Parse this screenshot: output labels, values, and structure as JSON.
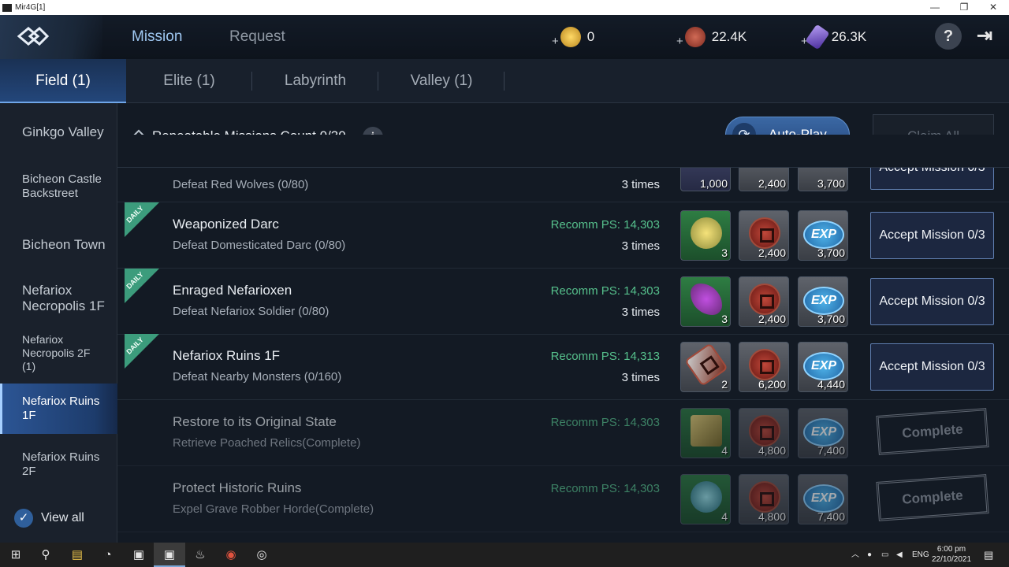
{
  "window": {
    "title": "Mir4G[1]",
    "minimize": "—",
    "restore": "❐",
    "close": "✕"
  },
  "header": {
    "main_tabs": [
      {
        "label": "Mission"
      },
      {
        "label": "Request"
      }
    ],
    "currencies": [
      {
        "name": "gold-icon",
        "value": "0",
        "color": "#e0b43a"
      },
      {
        "name": "copper-icon",
        "value": "22.4K",
        "color": "#b3523f"
      },
      {
        "name": "darksteel-icon",
        "value": "26.3K",
        "color": "#7a5bd0"
      }
    ],
    "help": "?",
    "exit": "⇥"
  },
  "sub_tabs": [
    {
      "label": "Field (1)"
    },
    {
      "label": "Elite (1)"
    },
    {
      "label": "Labyrinth"
    },
    {
      "label": "Valley (1)"
    }
  ],
  "sidebar": {
    "regions": [
      {
        "label": "Ginkgo Valley"
      },
      {
        "label": "Bicheon Castle Backstreet"
      },
      {
        "label": "Bicheon Town"
      },
      {
        "label": "Nefariox Necropolis 1F"
      },
      {
        "label": "Nefariox Necropolis 2F (1)"
      },
      {
        "label": "Nefariox Ruins 1F"
      },
      {
        "label": "Nefariox Ruins 2F"
      }
    ],
    "view_all": "View all",
    "check": "✓"
  },
  "toolbar": {
    "repeatable": "Repeatable Missions Count 0/30",
    "info": "i",
    "auto_play": "Auto-Play",
    "refresh": "⟳",
    "claim_all": "Claim All"
  },
  "missions": [
    {
      "title": "",
      "subtitle": "Defeat Red Wolves (0/80)",
      "ps": "",
      "times": "3 times",
      "daily": "",
      "rewards": [
        "1,000",
        "2,400",
        "3,700"
      ],
      "action": "Accept Mission 0/3"
    },
    {
      "title": "Weaponized Darc",
      "subtitle": "Defeat Domesticated Darc (0/80)",
      "ps": "Recomm PS: 14,303",
      "times": "3 times",
      "daily": "DAILY",
      "rewards": [
        "3",
        "2,400",
        "3,700"
      ],
      "action": "Accept Mission 0/3"
    },
    {
      "title": "Enraged Nefarioxen",
      "subtitle": "Defeat Nefariox Soldier (0/80)",
      "ps": "Recomm PS: 14,303",
      "times": "3 times",
      "daily": "DAILY",
      "rewards": [
        "3",
        "2,400",
        "3,700"
      ],
      "action": "Accept Mission 0/3"
    },
    {
      "title": "Nefariox Ruins 1F",
      "subtitle": "Defeat Nearby Monsters (0/160)",
      "ps": "Recomm PS: 14,313",
      "times": "3 times",
      "daily": "DAILY",
      "rewards": [
        "2",
        "6,200",
        "4,440"
      ],
      "action": "Accept Mission 0/3"
    },
    {
      "title": "Restore to its Original State",
      "subtitle": "Retrieve Poached Relics(Complete)",
      "ps": "Recomm PS: 14,303",
      "times": "",
      "daily": "",
      "rewards": [
        "4",
        "4,800",
        "7,400"
      ],
      "action": "Complete"
    },
    {
      "title": "Protect Historic Ruins",
      "subtitle": "Expel Grave Robber Horde(Complete)",
      "ps": "Recomm PS: 14,303",
      "times": "",
      "daily": "",
      "rewards": [
        "4",
        "4,800",
        "7,400"
      ],
      "action": "Complete"
    }
  ],
  "exp_label": "EXP",
  "taskbar": {
    "apps": [
      "⊞",
      "⚲",
      "▤",
      "◔",
      "▣",
      "▣",
      "♨",
      "◉",
      "◎"
    ],
    "lang": "ENG",
    "time": "6:00 pm",
    "date": "22/10/2021"
  }
}
